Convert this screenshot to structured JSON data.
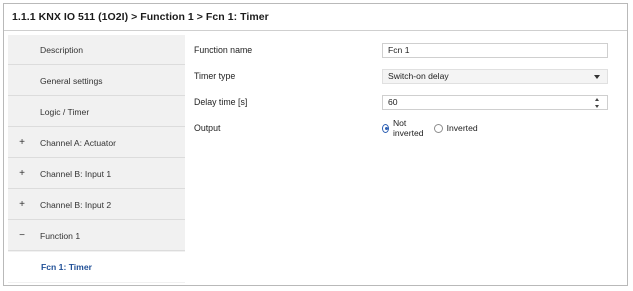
{
  "breadcrumb": "1.1.1 KNX IO 511 (1O2I) > Function 1 > Fcn 1: Timer",
  "sidebar": {
    "items": [
      {
        "prefix": "",
        "label": "Description"
      },
      {
        "prefix": "",
        "label": "General settings"
      },
      {
        "prefix": "",
        "label": "Logic / Timer"
      },
      {
        "prefix": "+",
        "label": "Channel A: Actuator"
      },
      {
        "prefix": "+",
        "label": "Channel B: Input 1"
      },
      {
        "prefix": "+",
        "label": "Channel B: Input 2"
      },
      {
        "prefix": "−",
        "label": "Function 1"
      },
      {
        "prefix": "",
        "label": "Fcn 1: Timer"
      }
    ]
  },
  "form": {
    "function_name": {
      "label": "Function name",
      "value": "Fcn 1"
    },
    "timer_type": {
      "label": "Timer type",
      "value": "Switch-on delay"
    },
    "delay_time": {
      "label": "Delay time [s]",
      "value": "60"
    },
    "output": {
      "label": "Output",
      "options": [
        "Not inverted",
        "Inverted"
      ],
      "selected": "Not inverted"
    }
  },
  "colors": {
    "accent": "#1f4f97",
    "sidebar_bg": "#f1f1f1"
  }
}
